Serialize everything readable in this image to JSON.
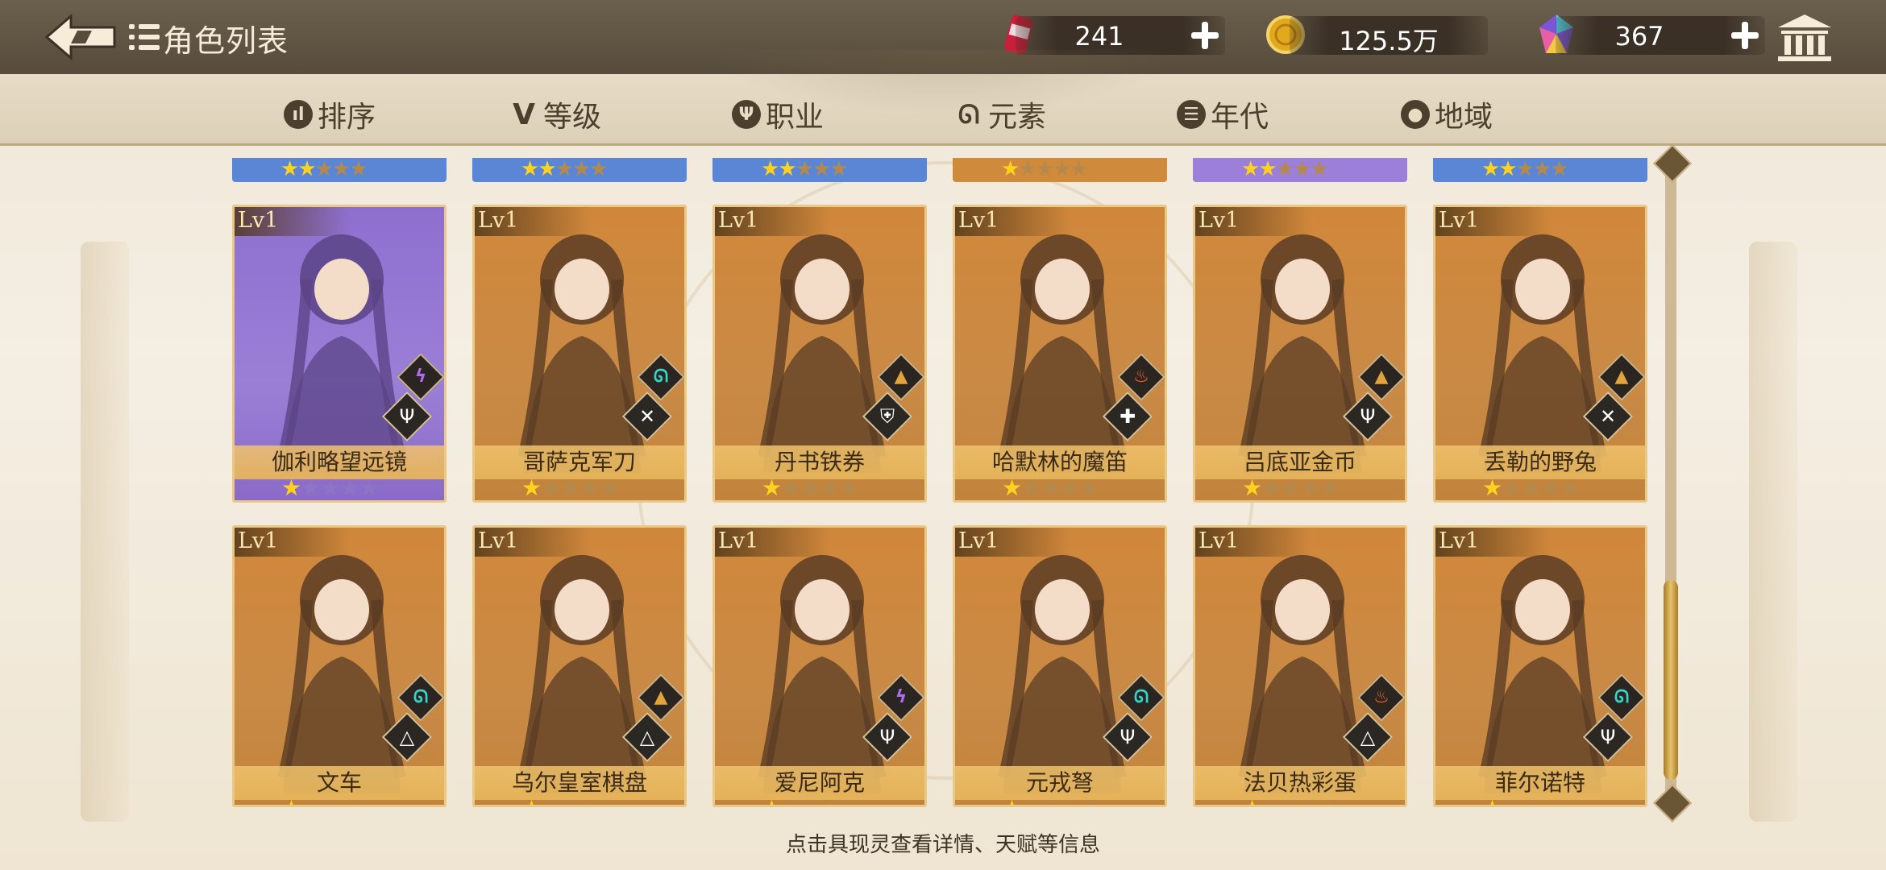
{
  "header": {
    "title": "角色列表",
    "resources": [
      {
        "name": "stamina",
        "value": "241"
      },
      {
        "name": "gold",
        "value": "125.5万"
      },
      {
        "name": "gems",
        "value": "367"
      }
    ]
  },
  "filters": [
    {
      "icon": "sort-icon",
      "label": "排序"
    },
    {
      "icon": "level-icon",
      "label": "等级"
    },
    {
      "icon": "profession-icon",
      "label": "职业"
    },
    {
      "icon": "element-icon",
      "label": "元素"
    },
    {
      "icon": "era-icon",
      "label": "年代"
    },
    {
      "icon": "region-icon",
      "label": "地域"
    }
  ],
  "top_partial_cards": [
    {
      "frame": "blue",
      "stars": 2
    },
    {
      "frame": "blue",
      "stars": 2
    },
    {
      "frame": "blue",
      "stars": 2
    },
    {
      "frame": "orange",
      "stars": 1
    },
    {
      "frame": "purple",
      "stars": 2
    },
    {
      "frame": "blue",
      "stars": 2
    }
  ],
  "cards": [
    {
      "level": "Lv1",
      "name": "伽利略望远镜",
      "frame": "purple",
      "stars": 1,
      "element": "lightning",
      "class": "trident"
    },
    {
      "level": "Lv1",
      "name": "哥萨克军刀",
      "frame": "orange",
      "stars": 1,
      "element": "wind",
      "class": "crossed-swords"
    },
    {
      "level": "Lv1",
      "name": "丹书铁券",
      "frame": "orange",
      "stars": 1,
      "element": "earth",
      "class": "shield"
    },
    {
      "level": "Lv1",
      "name": "哈默林的魔笛",
      "frame": "orange",
      "stars": 1,
      "element": "fire",
      "class": "staff"
    },
    {
      "level": "Lv1",
      "name": "吕底亚金币",
      "frame": "orange",
      "stars": 1,
      "element": "earth",
      "class": "trident"
    },
    {
      "level": "Lv1",
      "name": "丢勒的野兔",
      "frame": "orange",
      "stars": 1,
      "element": "earth",
      "class": "crossed-swords"
    },
    {
      "level": "Lv1",
      "name": "文车",
      "frame": "orange",
      "stars": 1,
      "element": "wind",
      "class": "pyramid"
    },
    {
      "level": "Lv1",
      "name": "乌尔皇室棋盘",
      "frame": "orange",
      "stars": 1,
      "element": "earth",
      "class": "pyramid"
    },
    {
      "level": "Lv1",
      "name": "爱尼阿克",
      "frame": "orange",
      "stars": 1,
      "element": "lightning",
      "class": "trident"
    },
    {
      "level": "Lv1",
      "name": "元戎弩",
      "frame": "orange",
      "stars": 1,
      "element": "wind",
      "class": "trident"
    },
    {
      "level": "Lv1",
      "name": "法贝热彩蛋",
      "frame": "orange",
      "stars": 1,
      "element": "fire",
      "class": "pyramid"
    },
    {
      "level": "Lv1",
      "name": "菲尔诺特",
      "frame": "orange",
      "stars": 1,
      "element": "wind",
      "class": "trident"
    }
  ],
  "footer_hint": "点击具现灵查看详情、天赋等信息",
  "colors": {
    "header_bg": "#574c3c",
    "card_orange": "#d9913a",
    "card_purple": "#8a6bc8",
    "strip_blue": "#5b86d6",
    "star_on": "#ffd21c"
  }
}
